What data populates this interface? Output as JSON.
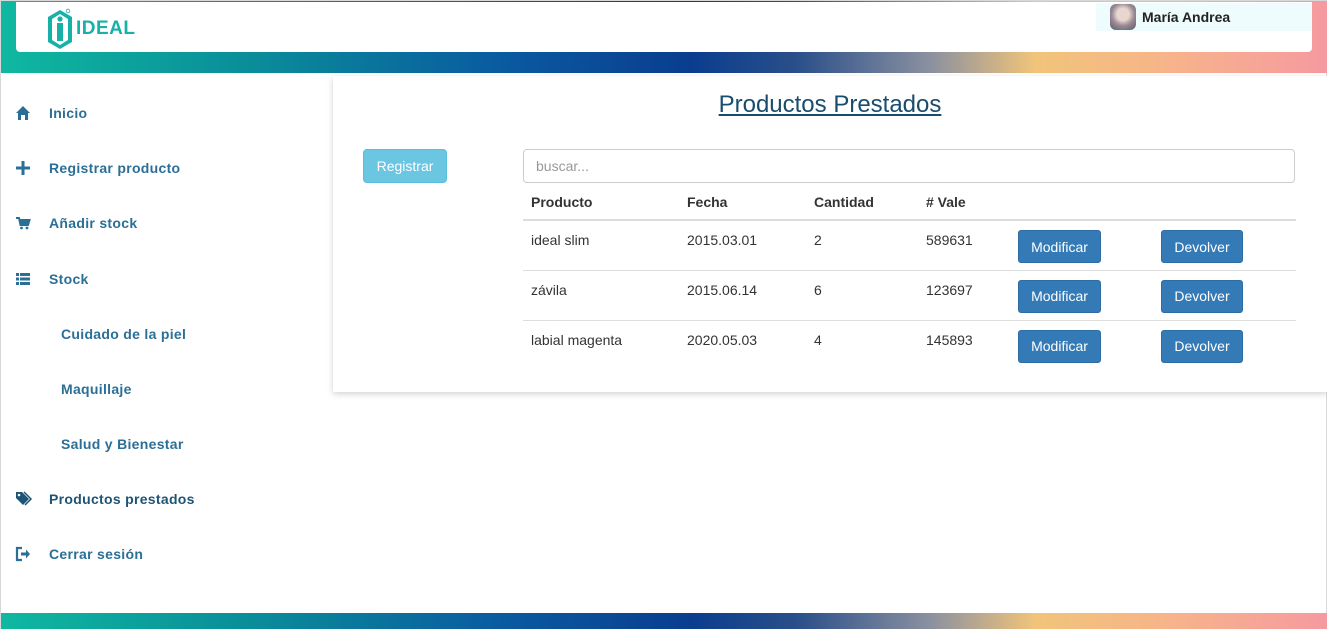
{
  "header": {
    "brand": "IDEAL",
    "user": {
      "name": "María Andrea"
    }
  },
  "sidebar": {
    "items": [
      {
        "label": "Inicio",
        "icon": "home-icon"
      },
      {
        "label": "Registrar producto",
        "icon": "plus-icon"
      },
      {
        "label": "Añadir stock",
        "icon": "cart-icon"
      },
      {
        "label": "Stock",
        "icon": "list-icon"
      },
      {
        "label": "Cuidado de la piel",
        "icon": ""
      },
      {
        "label": "Maquillaje",
        "icon": ""
      },
      {
        "label": "Salud y Bienestar",
        "icon": ""
      },
      {
        "label": "Productos prestados",
        "icon": "tags-icon"
      },
      {
        "label": "Cerrar sesión",
        "icon": "logout-icon"
      }
    ]
  },
  "main": {
    "title": "Productos Prestados",
    "register_label": "Registrar",
    "search_placeholder": "buscar...",
    "table": {
      "headers": [
        "Producto",
        "Fecha",
        "Cantidad",
        "# Vale",
        "",
        ""
      ],
      "rows": [
        {
          "producto": "ideal slim",
          "fecha": "2015.03.01",
          "cantidad": "2",
          "vale": "589631"
        },
        {
          "producto": "závila",
          "fecha": "2015.06.14",
          "cantidad": "6",
          "vale": "123697"
        },
        {
          "producto": "labial magenta",
          "fecha": "2020.05.03",
          "cantidad": "4",
          "vale": "145893"
        }
      ],
      "modify_label": "Modificar",
      "return_label": "Devolver"
    }
  },
  "colors": {
    "brand_teal": "#17b1a8",
    "nav_text": "#2a6f97",
    "primary_button": "#337ab7",
    "info_button": "#5bc0de"
  }
}
